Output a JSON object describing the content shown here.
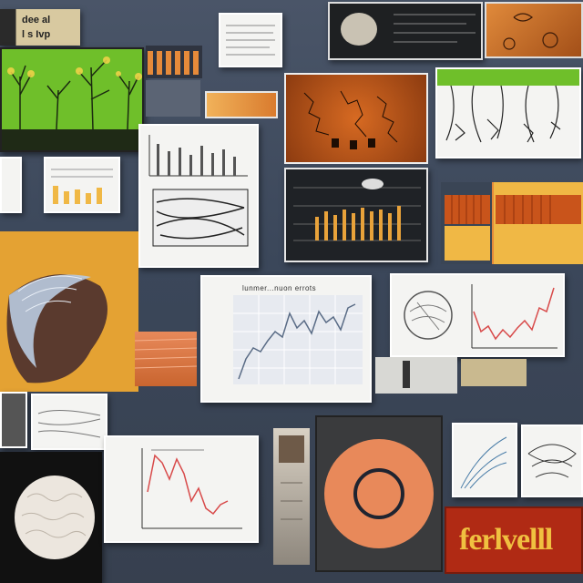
{
  "top_left_label": {
    "line1": "dee al",
    "line2": "l s Ivp"
  },
  "center_chart": {
    "title": "lunmer...nuon errots"
  },
  "brand_block": {
    "text": "ferlvelll"
  },
  "colors": {
    "backdrop": "#3f4b5f",
    "orange": "#e68a3a",
    "green": "#6fbf2a",
    "red_line": "#d84a4a",
    "salmon": "#e8895a",
    "brand_red": "#b02a14",
    "brand_text": "#f0c040"
  },
  "icons": [
    "tree-illustration",
    "shell-illustration",
    "brain-illustration",
    "ring-target"
  ]
}
